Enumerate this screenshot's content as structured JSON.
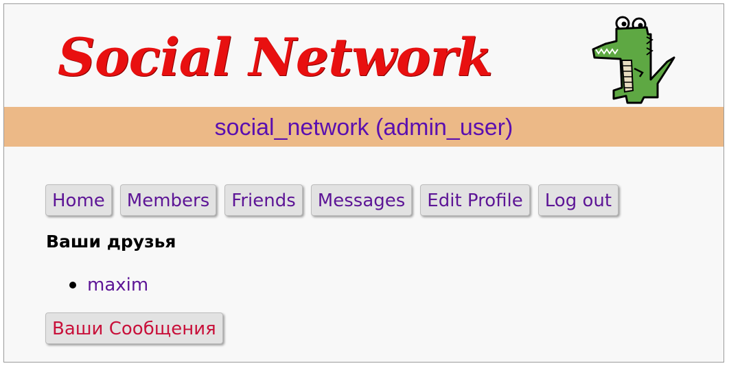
{
  "header": {
    "logo_text": "Social Network",
    "title": "social_network (admin_user)"
  },
  "nav": {
    "items": [
      {
        "label": "Home"
      },
      {
        "label": "Members"
      },
      {
        "label": "Friends"
      },
      {
        "label": "Messages"
      },
      {
        "label": "Edit Profile"
      },
      {
        "label": "Log out"
      }
    ]
  },
  "friends": {
    "heading": "Ваши друзья",
    "list": [
      {
        "name": "maxim"
      }
    ]
  },
  "messages_button": {
    "label": "Ваши Сообщения"
  },
  "colors": {
    "logo": "#e81010",
    "title_bar": "#ecb987",
    "title_text": "#5a0fb0",
    "link": "#5d1596",
    "messages_button_text": "#c8103a",
    "page_background": "#f8f8f8"
  },
  "icons": {
    "mascot": "crocodile-mascot-icon"
  }
}
